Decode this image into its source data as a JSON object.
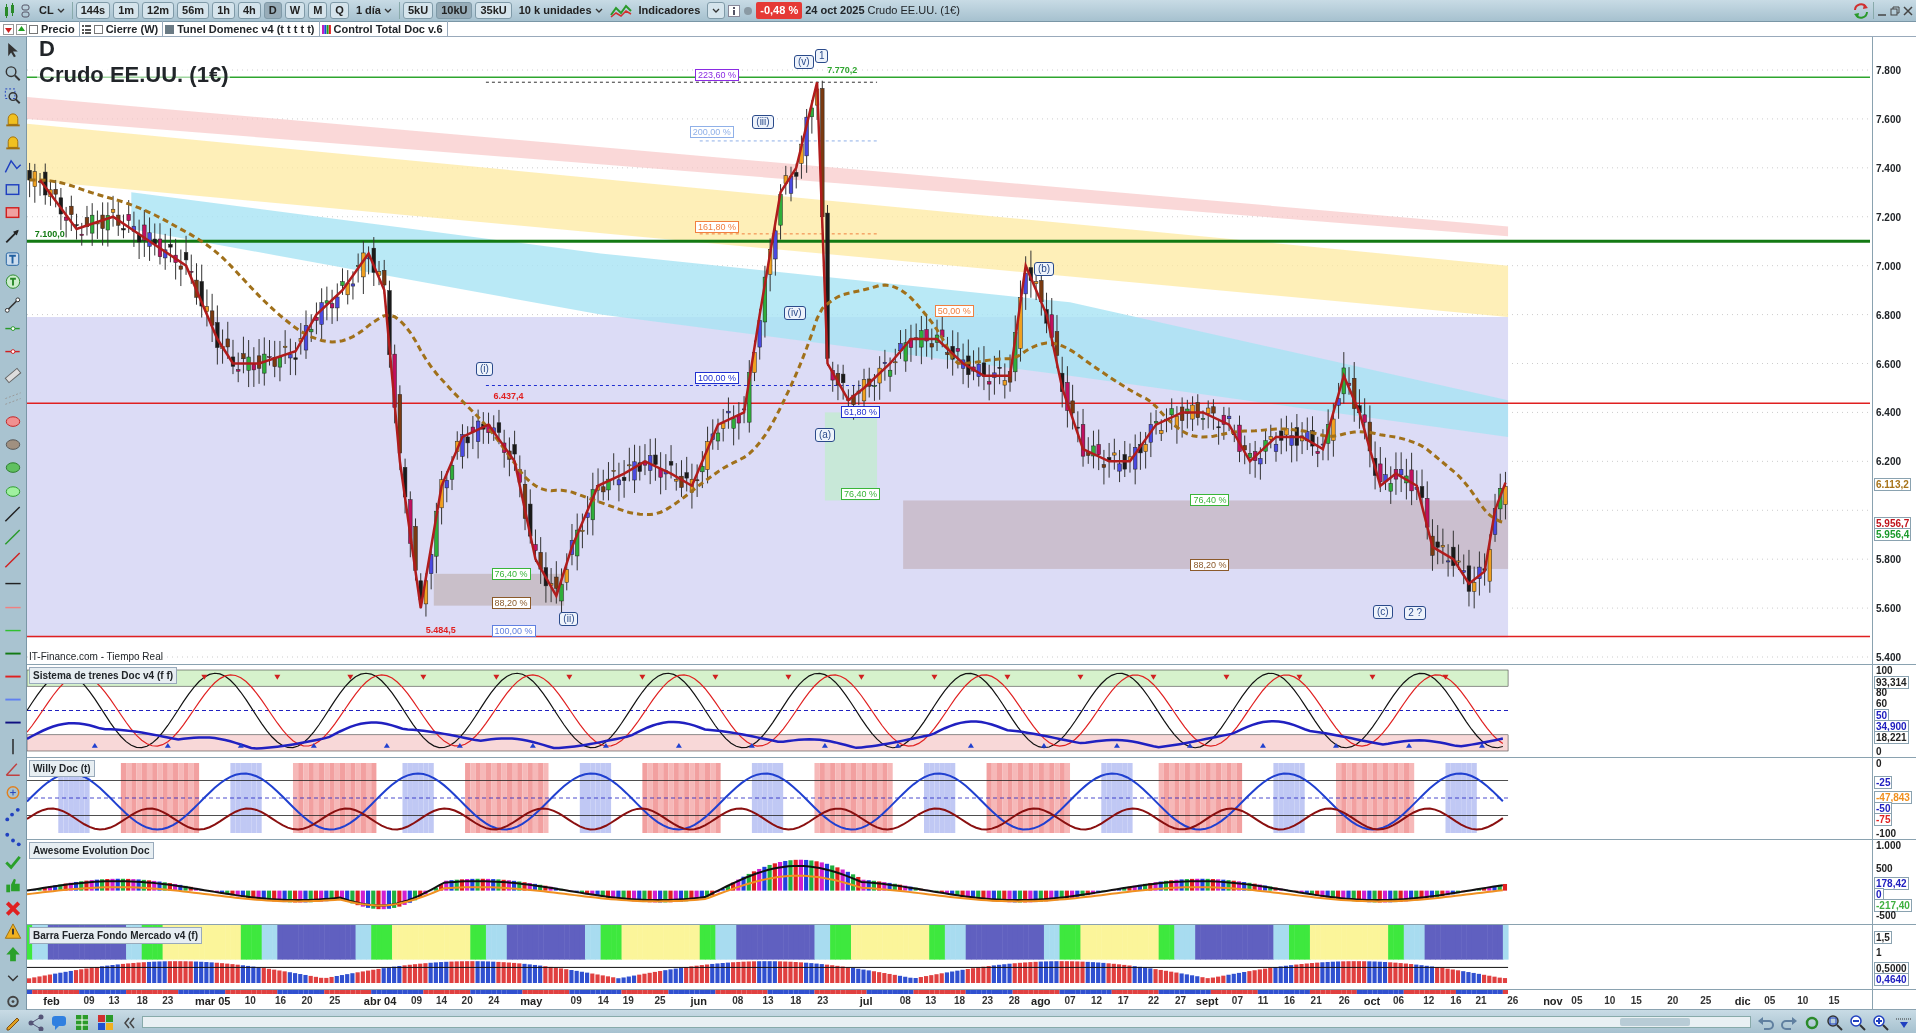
{
  "toolbar": {
    "symbol": "CL",
    "intervals": [
      {
        "label": "144s",
        "selected": false
      },
      {
        "label": "1m",
        "selected": false
      },
      {
        "label": "12m",
        "selected": false
      },
      {
        "label": "56m",
        "selected": false
      },
      {
        "label": "1h",
        "selected": false
      },
      {
        "label": "4h",
        "selected": false
      },
      {
        "label": "D",
        "selected": true
      },
      {
        "label": "W",
        "selected": false
      },
      {
        "label": "M",
        "selected": false
      },
      {
        "label": "Q",
        "selected": false
      }
    ],
    "period": "1 día",
    "units": [
      {
        "label": "5kU",
        "selected": false
      },
      {
        "label": "10kU",
        "selected": true
      },
      {
        "label": "35kU",
        "selected": false
      }
    ],
    "units_menu": "10 k unidades",
    "indicators_button": "Indicadores",
    "change": "-0,48 %",
    "date": "24 oct 2025",
    "instrument": "Crudo EE.UU. (1€)"
  },
  "legend": [
    {
      "kind": "checkbox",
      "label": "Precio",
      "checked": false
    },
    {
      "kind": "list",
      "label": "Cierre (W)",
      "checked": false
    },
    {
      "kind": "swatch",
      "label": "Tunel Domenec v4 (t t t t t)"
    },
    {
      "kind": "bars",
      "label": "Control Total Doc v.6"
    }
  ],
  "chart": {
    "letter": "D",
    "title": "Crudo EE.UU. (1€)",
    "source": "IT-Finance.com - Tiempo Real",
    "y_axis": [
      "7.800",
      "7.600",
      "7.400",
      "7.200",
      "7.000",
      "6.800",
      "6.600",
      "6.400",
      "6.200",
      "5.800",
      "5.600",
      "5.400"
    ],
    "price_tags": [
      {
        "label": "6.113,2",
        "color": "#a8741a"
      },
      {
        "label": "5.956,7",
        "color": "#c0141c"
      },
      {
        "label": "5.956,4",
        "color": "#1c9a2c"
      }
    ],
    "labels": [
      {
        "kind": "wave",
        "text": "1",
        "color": "#2a4a8a"
      },
      {
        "kind": "wave",
        "text": "(v)",
        "color": "#2a4a8a"
      },
      {
        "kind": "price",
        "text": "7.770,2",
        "color": "#2ea52e"
      },
      {
        "kind": "fib",
        "text": "223,60 %",
        "color": "#8a2be2"
      },
      {
        "kind": "wave",
        "text": "(iii)",
        "color": "#2a4a8a"
      },
      {
        "kind": "fib",
        "text": "200,00 %",
        "color": "#8fb0e8"
      },
      {
        "kind": "fib",
        "text": "161,80 %",
        "color": "#f08040"
      },
      {
        "kind": "price",
        "text": "7.100,0",
        "color": "#137a13"
      },
      {
        "kind": "wave",
        "text": "(b)",
        "color": "#2a4a8a"
      },
      {
        "kind": "fib",
        "text": "50,00 %",
        "color": "#f08040"
      },
      {
        "kind": "wave",
        "text": "(iv)",
        "color": "#2a4a8a"
      },
      {
        "kind": "wave",
        "text": "(i)",
        "color": "#2a4a8a"
      },
      {
        "kind": "fib",
        "text": "100,00 %",
        "color": "#2030d0"
      },
      {
        "kind": "price",
        "text": "6.437,4",
        "color": "#e02020"
      },
      {
        "kind": "fib",
        "text": "61,80 %",
        "color": "#2030d0"
      },
      {
        "kind": "wave",
        "text": "(a)",
        "color": "#2a4a8a"
      },
      {
        "kind": "fib",
        "text": "76,40 %",
        "color": "#39b539"
      },
      {
        "kind": "fib",
        "text": "76,40 %",
        "color": "#39b539"
      },
      {
        "kind": "fib",
        "text": "88,20 %",
        "color": "#8b5a2b"
      },
      {
        "kind": "fib",
        "text": "76,40 %",
        "color": "#39b539"
      },
      {
        "kind": "fib",
        "text": "88,20 %",
        "color": "#8b5a2b"
      },
      {
        "kind": "wave",
        "text": "(c)",
        "color": "#2a4a8a"
      },
      {
        "kind": "wave",
        "text": "2 ?",
        "color": "#2a4a8a"
      },
      {
        "kind": "wave",
        "text": "(ii)",
        "color": "#2a4a8a"
      },
      {
        "kind": "price",
        "text": "5.484,5",
        "color": "#e02020"
      },
      {
        "kind": "fib",
        "text": "100,00 %",
        "color": "#6080e0"
      }
    ]
  },
  "indicators": [
    {
      "kind": "trains",
      "title": "Sistema de trenes Doc v4 (f f)",
      "axis": [
        {
          "label": "100",
          "color": "#222222"
        },
        {
          "label": "93,314",
          "color": "#222222"
        },
        {
          "label": "80",
          "color": "#222222"
        },
        {
          "label": "60",
          "color": "#222222"
        },
        {
          "label": "50",
          "color": "#2020c0"
        },
        {
          "label": "34,900",
          "color": "#2020c0"
        },
        {
          "label": "18,221",
          "color": "#222222"
        },
        {
          "label": "0",
          "color": "#222222"
        }
      ]
    },
    {
      "kind": "willy",
      "title": "Willy Doc (t)",
      "axis": [
        {
          "label": "0",
          "color": "#222222"
        },
        {
          "label": "-25",
          "color": "#2020c0"
        },
        {
          "label": "-47,843",
          "color": "#f09020"
        },
        {
          "label": "-50",
          "color": "#2020c0"
        },
        {
          "label": "-75",
          "color": "#e02020"
        },
        {
          "label": "-100",
          "color": "#222222"
        }
      ]
    },
    {
      "kind": "awesome",
      "title": "Awesome Evolution Doc",
      "axis": [
        {
          "label": "1.000",
          "color": "#222222"
        },
        {
          "label": "500",
          "color": "#222222"
        },
        {
          "label": "178,42",
          "color": "#2020c0"
        },
        {
          "label": "0",
          "color": "#2020c0"
        },
        {
          "label": "-217,40",
          "color": "#40b040"
        },
        {
          "label": "-500",
          "color": "#222222"
        }
      ]
    },
    {
      "kind": "strength",
      "title": "Barra Fuerza Fondo Mercado v4 (f)",
      "axis": [
        {
          "label": "1,5",
          "color": "#222222"
        },
        {
          "label": "1",
          "color": "#222222"
        },
        {
          "label": "0,5000",
          "color": "#222222"
        },
        {
          "label": "0,4640",
          "color": "#2020c0"
        }
      ]
    }
  ],
  "x_axis": [
    {
      "label": "feb",
      "kind": "month"
    },
    {
      "label": "09",
      "kind": "day"
    },
    {
      "label": "13",
      "kind": "day"
    },
    {
      "label": "18",
      "kind": "day"
    },
    {
      "label": "23",
      "kind": "day"
    },
    {
      "label": "mar 05",
      "kind": "month"
    },
    {
      "label": "10",
      "kind": "day"
    },
    {
      "label": "16",
      "kind": "day"
    },
    {
      "label": "20",
      "kind": "day"
    },
    {
      "label": "25",
      "kind": "day"
    },
    {
      "label": "abr 04",
      "kind": "month"
    },
    {
      "label": "09",
      "kind": "day"
    },
    {
      "label": "14",
      "kind": "day"
    },
    {
      "label": "20",
      "kind": "day"
    },
    {
      "label": "24",
      "kind": "day"
    },
    {
      "label": "may",
      "kind": "month"
    },
    {
      "label": "09",
      "kind": "day"
    },
    {
      "label": "14",
      "kind": "day"
    },
    {
      "label": "19",
      "kind": "day"
    },
    {
      "label": "25",
      "kind": "day"
    },
    {
      "label": "jun",
      "kind": "month"
    },
    {
      "label": "08",
      "kind": "day"
    },
    {
      "label": "13",
      "kind": "day"
    },
    {
      "label": "18",
      "kind": "day"
    },
    {
      "label": "23",
      "kind": "day"
    },
    {
      "label": "jul",
      "kind": "month"
    },
    {
      "label": "08",
      "kind": "day"
    },
    {
      "label": "13",
      "kind": "day"
    },
    {
      "label": "18",
      "kind": "day"
    },
    {
      "label": "23",
      "kind": "day"
    },
    {
      "label": "28",
      "kind": "day"
    },
    {
      "label": "ago",
      "kind": "month"
    },
    {
      "label": "07",
      "kind": "day"
    },
    {
      "label": "12",
      "kind": "day"
    },
    {
      "label": "17",
      "kind": "day"
    },
    {
      "label": "22",
      "kind": "day"
    },
    {
      "label": "27",
      "kind": "day"
    },
    {
      "label": "sept",
      "kind": "month"
    },
    {
      "label": "07",
      "kind": "day"
    },
    {
      "label": "11",
      "kind": "day"
    },
    {
      "label": "16",
      "kind": "day"
    },
    {
      "label": "21",
      "kind": "day"
    },
    {
      "label": "26",
      "kind": "day"
    },
    {
      "label": "oct",
      "kind": "month"
    },
    {
      "label": "06",
      "kind": "day"
    },
    {
      "label": "12",
      "kind": "day"
    },
    {
      "label": "16",
      "kind": "day"
    },
    {
      "label": "21",
      "kind": "day"
    },
    {
      "label": "26",
      "kind": "day"
    },
    {
      "label": "nov",
      "kind": "month"
    },
    {
      "label": "05",
      "kind": "day"
    },
    {
      "label": "10",
      "kind": "day"
    },
    {
      "label": "15",
      "kind": "day"
    },
    {
      "label": "20",
      "kind": "day"
    },
    {
      "label": "25",
      "kind": "day"
    },
    {
      "label": "dic",
      "kind": "month"
    },
    {
      "label": "05",
      "kind": "day"
    },
    {
      "label": "10",
      "kind": "day"
    },
    {
      "label": "15",
      "kind": "day"
    }
  ]
}
